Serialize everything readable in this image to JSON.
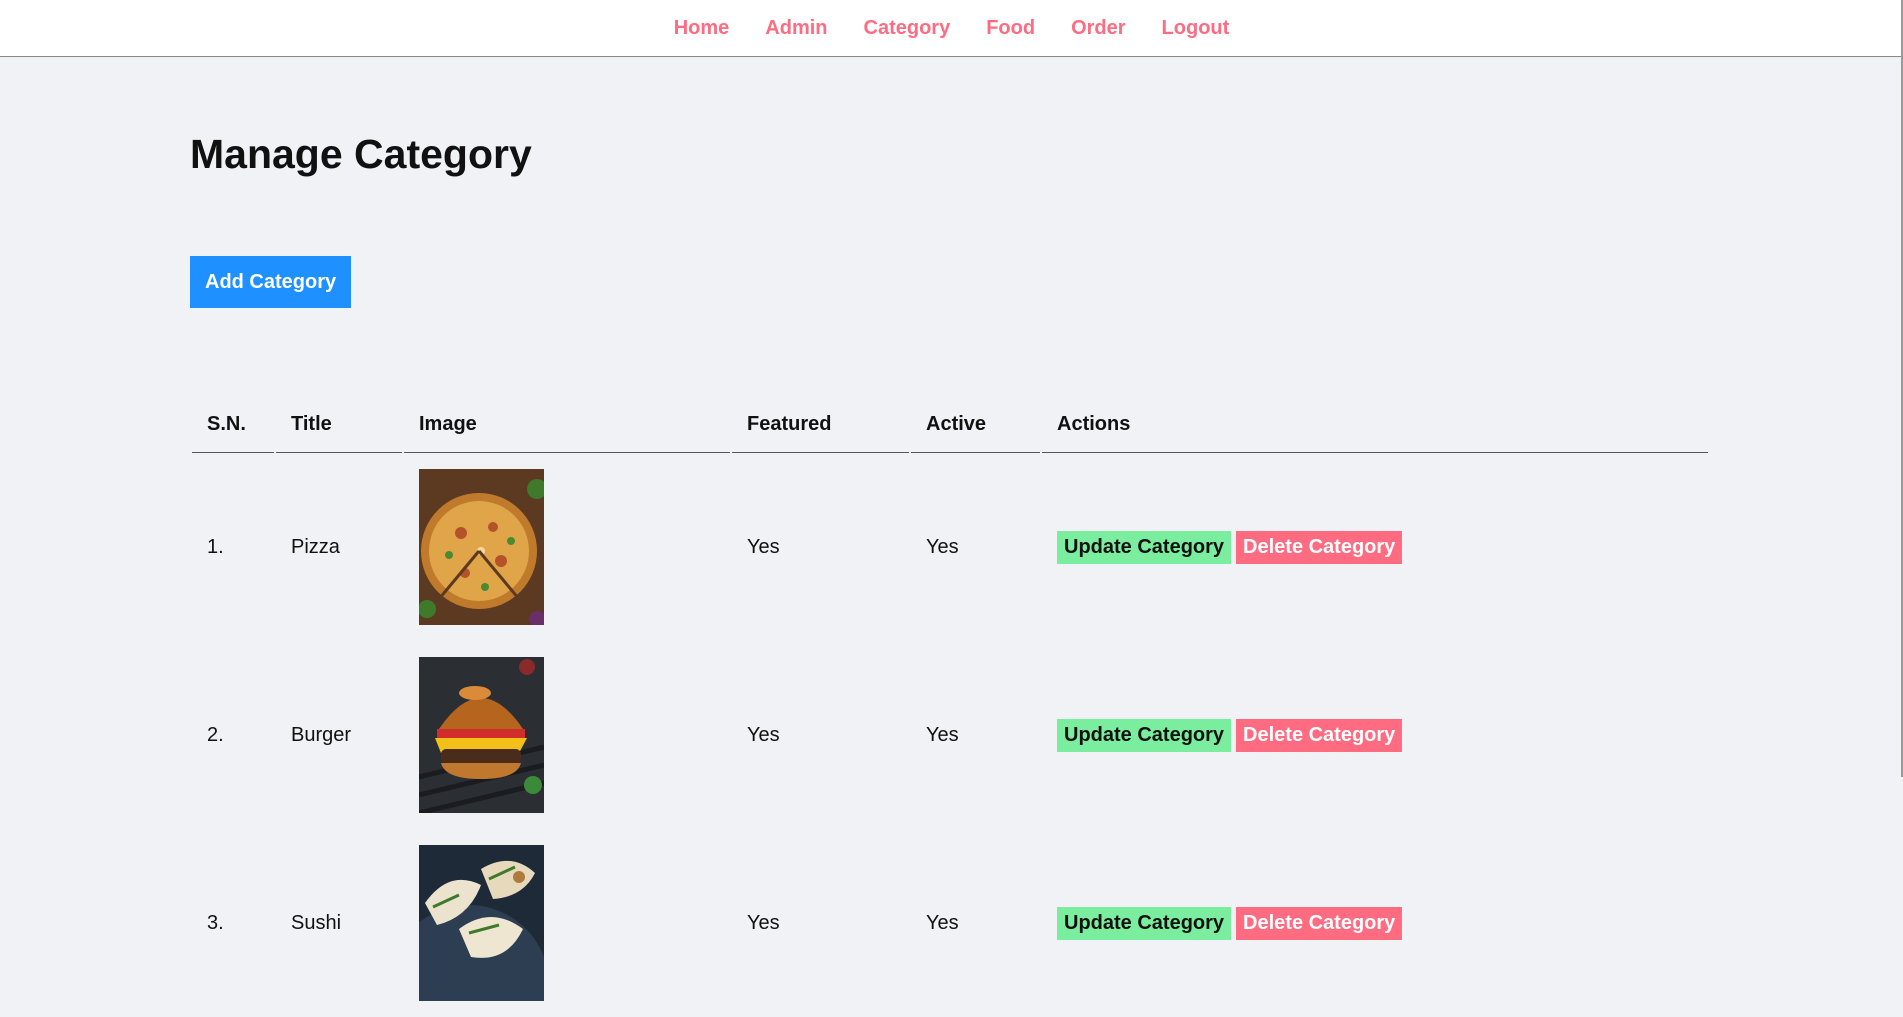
{
  "nav": {
    "items": [
      "Home",
      "Admin",
      "Category",
      "Food",
      "Order",
      "Logout"
    ]
  },
  "page": {
    "title": "Manage Category",
    "add_button": "Add Category"
  },
  "table": {
    "headers": [
      "S.N.",
      "Title",
      "Image",
      "Featured",
      "Active",
      "Actions"
    ],
    "rows": [
      {
        "sn": "1.",
        "title": "Pizza",
        "image_icon": "pizza-image",
        "featured": "Yes",
        "active": "Yes"
      },
      {
        "sn": "2.",
        "title": "Burger",
        "image_icon": "burger-image",
        "featured": "Yes",
        "active": "Yes"
      },
      {
        "sn": "3.",
        "title": "Sushi",
        "image_icon": "dumplings-image",
        "featured": "Yes",
        "active": "Yes"
      }
    ],
    "update_label": "Update Category",
    "delete_label": "Delete Category"
  },
  "colors": {
    "nav_link": "#ff6b81",
    "primary_button": "#1e90ff",
    "update_button": "#7bed9f",
    "delete_button": "#ff6b81",
    "background": "#f1f2f6"
  }
}
